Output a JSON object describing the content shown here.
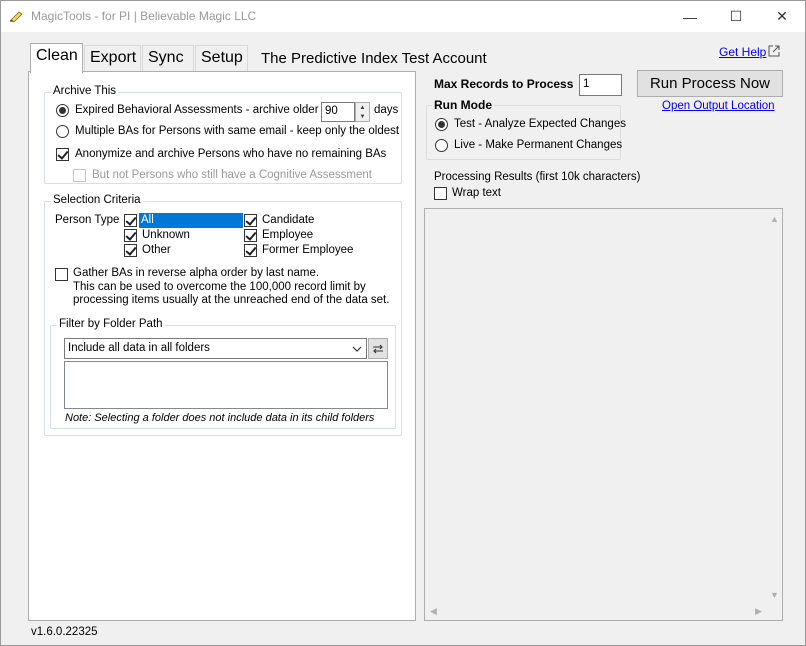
{
  "window": {
    "title": "MagicTools - for PI | Believable Magic LLC",
    "minimize": "—",
    "maximize": "☐",
    "close": "✕"
  },
  "tabs": [
    "Clean",
    "Export",
    "Sync",
    "Setup"
  ],
  "account": "The Predictive Index Test Account",
  "help": "Get Help",
  "archive": {
    "title": "Archive This",
    "expired_label": "Expired Behavioral Assessments - archive older than",
    "days_value": "90",
    "days_label": "days",
    "multiple_label": "Multiple BAs for Persons with same email - keep only the oldest",
    "anonymize_label": "Anonymize and archive Persons who have no remaining BAs",
    "cognitive_label": "But not Persons who still have a Cognitive Assessment"
  },
  "selection": {
    "title": "Selection Criteria",
    "person_type_label": "Person Type",
    "types": [
      "All",
      "Unknown",
      "Other",
      "Candidate",
      "Employee",
      "Former Employee"
    ],
    "reverse_line1": "Gather BAs in reverse alpha order by last name.",
    "reverse_line2": "This can be used to overcome the 100,000 record limit by",
    "reverse_line3": "processing items usually at the unreached end of the data set."
  },
  "folder": {
    "title": "Filter by Folder Path",
    "selected": "Include all data in all folders",
    "note": "Note: Selecting a folder does not include data in its child folders"
  },
  "version": "v1.6.0.22325",
  "right": {
    "max_records_label": "Max Records to Process",
    "max_records_value": "1",
    "run_button": "Run Process Now",
    "open_output": "Open Output Location",
    "run_mode_title": "Run Mode",
    "test_label": "Test - Analyze Expected Changes",
    "live_label": "Live - Make Permanent Changes",
    "results_label": "Processing Results (first 10k characters)",
    "wrap_label": "Wrap text"
  }
}
